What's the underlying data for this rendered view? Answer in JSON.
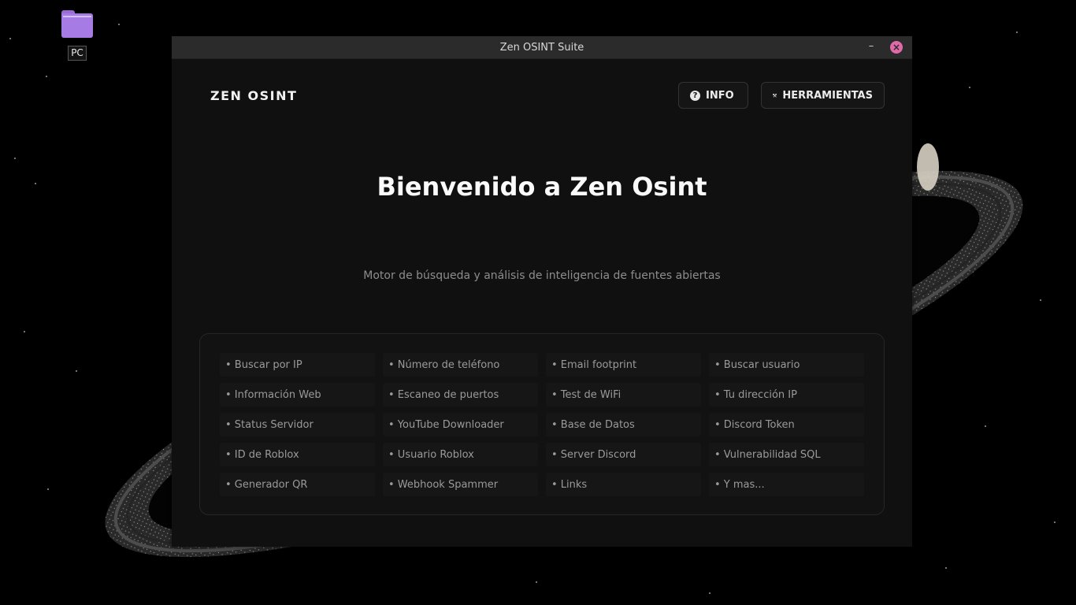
{
  "desktop": {
    "icon_name": "folder-icon",
    "label": "PC"
  },
  "window": {
    "title": "Zen OSINT Suite",
    "minimize_glyph": "–",
    "close_glyph": "×"
  },
  "header": {
    "logo": "ZEN OSINT",
    "info_label": "INFO",
    "info_icon": "question-circle-icon",
    "tools_label": "HERRAMIENTAS",
    "tools_icon": "tools-icon"
  },
  "hero": {
    "title": "Bienvenido a Zen Osint",
    "subtitle": "Motor de búsqueda y análisis de inteligencia de fuentes abiertas"
  },
  "features": [
    "• Buscar por IP",
    "• Número de teléfono",
    "• Email footprint",
    "• Buscar usuario",
    "• Información Web",
    "• Escaneo de puertos",
    "• Test de WiFi",
    "• Tu dirección IP",
    "• Status Servidor",
    "• YouTube Downloader",
    "• Base de Datos",
    "• Discord Token",
    "• ID de Roblox",
    "• Usuario Roblox",
    "• Server Discord",
    "• Vulnerabilidad SQL",
    "• Generador QR",
    "• Webhook Spammer",
    "• Links",
    "• Y mas..."
  ],
  "colors": {
    "accent_close": "#e06aa9",
    "folder": "#a77be4",
    "window_bg": "#101011"
  }
}
